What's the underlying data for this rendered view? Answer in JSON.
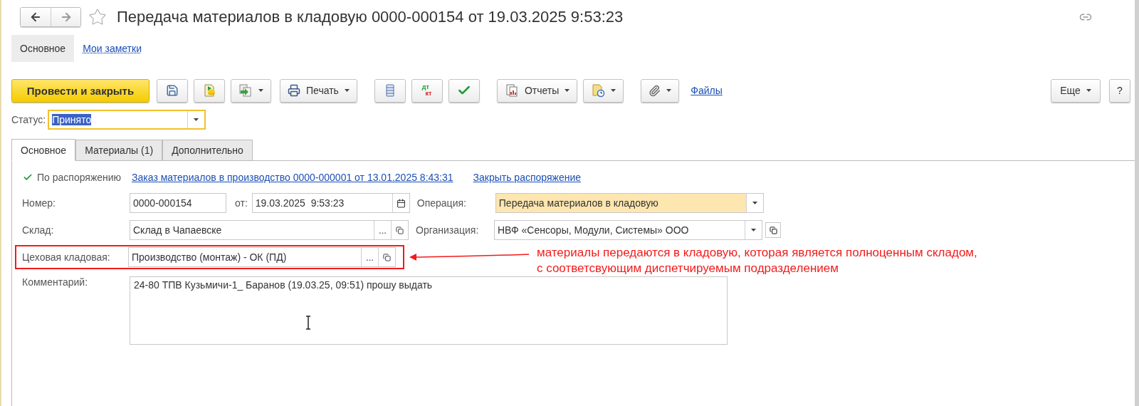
{
  "window": {
    "title": "Передача материалов в кладовую 0000-000154 от 19.03.2025 9:53:23",
    "favorite": false
  },
  "nav_tabs": [
    {
      "label": "Основное",
      "selected": true
    },
    {
      "label": "Мои заметки",
      "selected": false
    }
  ],
  "toolbar": {
    "post_button": "Провести и закрыть",
    "print_button": "Печать",
    "dt_kt": {
      "top": "дт",
      "bottom": "кт"
    },
    "reports_button": "Отчеты",
    "files_link": "Файлы",
    "more_button": "Еще",
    "help_button": "?"
  },
  "status": {
    "label": "Статус:",
    "value": "Принято"
  },
  "form_tabs": [
    {
      "label": "Основное",
      "selected": true
    },
    {
      "label": "Материалы (1)",
      "selected": false
    },
    {
      "label": "Дополнительно",
      "selected": false
    }
  ],
  "by_order": {
    "label": "По распоряжению",
    "checked": true,
    "order_link": "Заказ материалов в производство 0000-000001 от 13.01.2025 8:43:31",
    "close_link": "Закрыть распоряжение"
  },
  "number": {
    "label": "Номер:",
    "value": "0000-000154"
  },
  "date": {
    "label": "от:",
    "value": "19.03.2025  9:53:23"
  },
  "operation": {
    "label": "Операция:",
    "value": "Передача материалов в кладовую"
  },
  "warehouse": {
    "label": "Склад:",
    "value": "Склад в Чапаевске",
    "select_button": "..."
  },
  "organization": {
    "label": "Организация:",
    "value": "НВФ «Сенсоры, Модули, Системы» ООО"
  },
  "shop_storage": {
    "label": "Цеховая кладовая:",
    "value": "Производство (монтаж) - ОК (ПД)",
    "select_button": "..."
  },
  "comment": {
    "label": "Комментарий:",
    "value": "24-80 ТПВ Кузьмичи-1_ Баранов (19.03.25, 09:51) прошу выдать"
  },
  "annotation": {
    "lines": [
      "материалы передаются в кладовую, которая является полноценным складом,",
      "с соответсвующим диспетчируемым подразделением"
    ]
  }
}
